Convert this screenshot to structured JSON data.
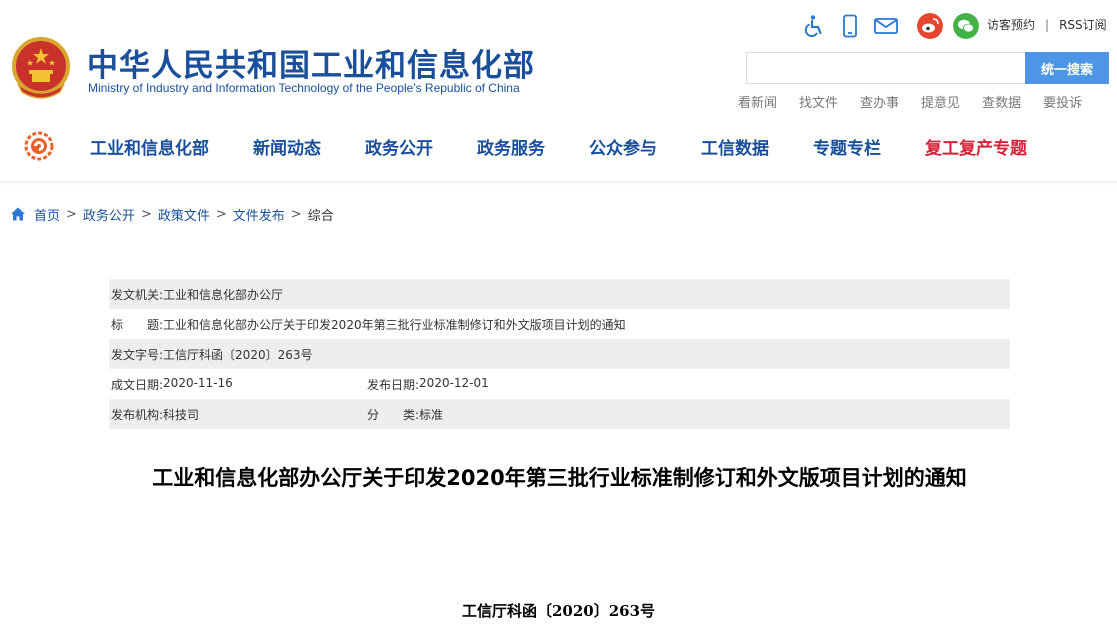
{
  "header": {
    "site_title": "中华人民共和国工业和信息化部",
    "site_subtitle": "Ministry of Industry and Information Technology of the People's Republic of China",
    "top_links": [
      "访客预约",
      "RSS订阅"
    ],
    "top_links_separator": "|",
    "top_icons": [
      "accessibility-icon",
      "mobile-icon",
      "mail-icon",
      "weibo-icon",
      "wechat-icon"
    ],
    "search": {
      "placeholder": "",
      "button_label": "统一搜索"
    },
    "quick_links": [
      "看新闻",
      "找文件",
      "查办事",
      "提意见",
      "查数据",
      "要投诉"
    ],
    "brand_color": "#1a4f9c",
    "accent_color": "#d6243a"
  },
  "nav": {
    "items": [
      "工业和信息化部",
      "新闻动态",
      "政务公开",
      "政务服务",
      "公众参与",
      "工信数据",
      "专题专栏",
      "复工复产专题"
    ]
  },
  "breadcrumb": {
    "items": [
      "首页",
      "政务公开",
      "政策文件",
      "文件发布",
      "综合"
    ],
    "separator": ">"
  },
  "meta": {
    "issuer_label": "发文机关:",
    "issuer": "工业和信息化部办公厅",
    "title_label": "标　　题:",
    "title": "工业和信息化部办公厅关于印发2020年第三批行业标准制修订和外文版项目计划的通知",
    "doc_no_label": "发文字号:",
    "doc_no": "工信厅科函〔2020〕263号",
    "created_label": "成文日期:",
    "created": "2020-11-16",
    "published_label": "发布日期:",
    "published": "2020-12-01",
    "org_label": "发布机构:",
    "org": "科技司",
    "category_label": "分　　类:",
    "category": "标准"
  },
  "article": {
    "title": "工业和信息化部办公厅关于印发2020年第三批行业标准制修订和外文版项目计划的通知",
    "doc_number": "工信厅科函〔2020〕263号"
  }
}
